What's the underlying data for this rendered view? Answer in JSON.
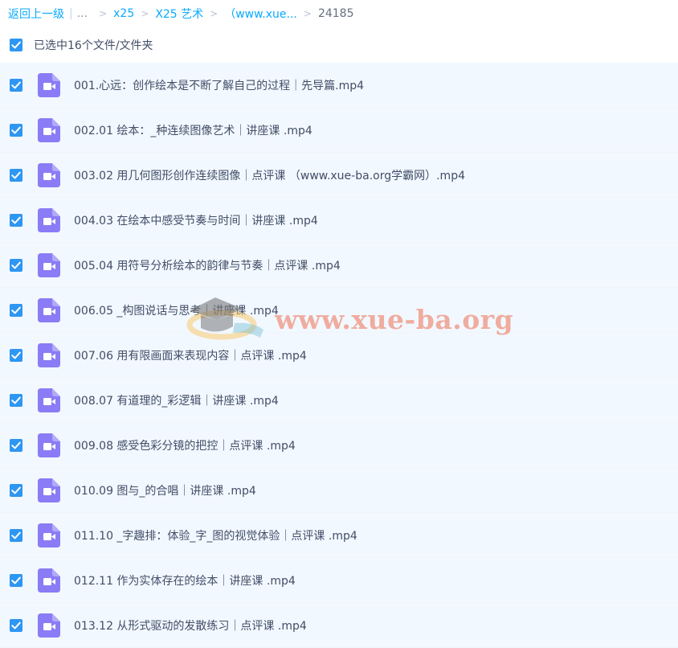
{
  "breadcrumb": {
    "back": "返回上一级",
    "ellipsis": "...",
    "items": [
      "x25",
      "X25 艺术",
      "（www.xue..."
    ],
    "current": "24185"
  },
  "selection": {
    "text": "已选中16个文件/文件夹"
  },
  "files": [
    "001.心远：创作绘本是不断了解自己的过程｜先导篇.mp4",
    "002.01 绘本：_种连续图像艺术｜讲座课 .mp4",
    "003.02 用几何图形创作连续图像｜点评课 （www.xue-ba.org学霸网）.mp4",
    "004.03 在绘本中感受节奏与时间｜讲座课 .mp4",
    "005.04 用符号分析绘本的韵律与节奏｜点评课 .mp4",
    "006.05 _构图说话与思考｜讲座课 .mp4",
    "007.06 用有限画面来表现内容｜点评课 .mp4",
    "008.07 有道理的_彩逻辑｜讲座课 .mp4",
    "009.08 感受色彩分镜的把控｜点评课 .mp4",
    "010.09 图与_的合唱｜讲座课 .mp4",
    "011.10 _字趣排：体验_字_图的视觉体验｜点评课 .mp4",
    "012.11 作为实体存在的绘本｜讲座课 .mp4",
    "013.12 从形式驱动的发散练习｜点评课 .mp4"
  ],
  "watermark": "www.xue-ba.org",
  "colors": {
    "link": "#09aaff",
    "checkbox": "#2e96f3",
    "row_selected": "#f2f8ff",
    "video_icon": "#8a7cf6"
  },
  "icons": {
    "checkbox": "check-icon",
    "file": "video-file-icon"
  }
}
